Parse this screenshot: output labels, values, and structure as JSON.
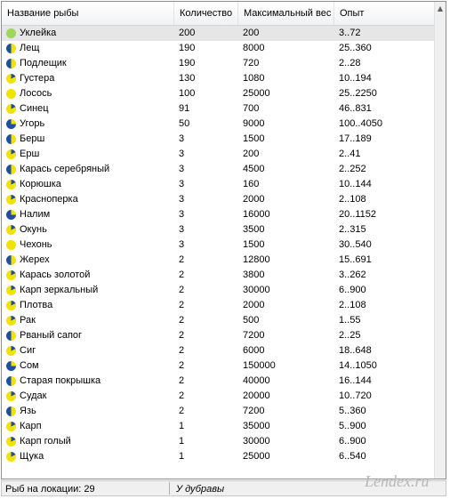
{
  "columns": {
    "name": "Название рыбы",
    "qty": "Количество",
    "max_weight": "Максимальный вес",
    "experience": "Опыт"
  },
  "colors": {
    "row_selected": "#e6e6e6",
    "icon_blue": "#1f4fa3",
    "icon_yellow": "#f2e200",
    "icon_green": "#9ed65a"
  },
  "rows": [
    {
      "name": "Уклейка",
      "qty": "200",
      "max": "200",
      "exp": "3..72",
      "selected": true,
      "icon": "green-circle"
    },
    {
      "name": "Лещ",
      "qty": "190",
      "max": "8000",
      "exp": "25..360",
      "icon": "pie-half"
    },
    {
      "name": "Подлещик",
      "qty": "190",
      "max": "720",
      "exp": "2..28",
      "icon": "pie-half"
    },
    {
      "name": "Густера",
      "qty": "130",
      "max": "1080",
      "exp": "10..194",
      "icon": "pie-small"
    },
    {
      "name": "Лосось",
      "qty": "100",
      "max": "25000",
      "exp": "25..2250",
      "icon": "yellow-circle"
    },
    {
      "name": "Синец",
      "qty": "91",
      "max": "700",
      "exp": "46..831",
      "icon": "pie-small"
    },
    {
      "name": "Угорь",
      "qty": "50",
      "max": "9000",
      "exp": "100..4050",
      "icon": "pie-three-quarter"
    },
    {
      "name": "Берш",
      "qty": "3",
      "max": "1500",
      "exp": "17..189",
      "icon": "pie-half"
    },
    {
      "name": "Ерш",
      "qty": "3",
      "max": "200",
      "exp": "2..41",
      "icon": "pie-small"
    },
    {
      "name": "Карась серебряный",
      "qty": "3",
      "max": "4500",
      "exp": "2..252",
      "icon": "pie-half"
    },
    {
      "name": "Корюшка",
      "qty": "3",
      "max": "160",
      "exp": "10..144",
      "icon": "pie-small"
    },
    {
      "name": "Красноперка",
      "qty": "3",
      "max": "2000",
      "exp": "2..108",
      "icon": "pie-small"
    },
    {
      "name": "Налим",
      "qty": "3",
      "max": "16000",
      "exp": "20..1152",
      "icon": "pie-three-quarter"
    },
    {
      "name": "Окунь",
      "qty": "3",
      "max": "3500",
      "exp": "2..315",
      "icon": "pie-small"
    },
    {
      "name": "Чехонь",
      "qty": "3",
      "max": "1500",
      "exp": "30..540",
      "icon": "yellow-circle"
    },
    {
      "name": "Жерех",
      "qty": "2",
      "max": "12800",
      "exp": "15..691",
      "icon": "pie-half"
    },
    {
      "name": "Карась золотой",
      "qty": "2",
      "max": "3800",
      "exp": "3..262",
      "icon": "pie-small"
    },
    {
      "name": "Карп зеркальный",
      "qty": "2",
      "max": "30000",
      "exp": "6..900",
      "icon": "pie-small"
    },
    {
      "name": "Плотва",
      "qty": "2",
      "max": "2000",
      "exp": "2..108",
      "icon": "pie-small"
    },
    {
      "name": "Рак",
      "qty": "2",
      "max": "500",
      "exp": "1..55",
      "icon": "pie-small"
    },
    {
      "name": "Рваный сапог",
      "qty": "2",
      "max": "7200",
      "exp": "2..25",
      "icon": "pie-half"
    },
    {
      "name": "Сиг",
      "qty": "2",
      "max": "6000",
      "exp": "18..648",
      "icon": "pie-small"
    },
    {
      "name": "Сом",
      "qty": "2",
      "max": "150000",
      "exp": "14..1050",
      "icon": "pie-three-quarter"
    },
    {
      "name": "Старая покрышка",
      "qty": "2",
      "max": "40000",
      "exp": "16..144",
      "icon": "pie-half"
    },
    {
      "name": "Судак",
      "qty": "2",
      "max": "20000",
      "exp": "10..720",
      "icon": "pie-small"
    },
    {
      "name": "Язь",
      "qty": "2",
      "max": "7200",
      "exp": "5..360",
      "icon": "pie-half"
    },
    {
      "name": "Карп",
      "qty": "1",
      "max": "35000",
      "exp": "5..900",
      "icon": "pie-small"
    },
    {
      "name": "Карп голый",
      "qty": "1",
      "max": "30000",
      "exp": "6..900",
      "icon": "pie-small"
    },
    {
      "name": "Щука",
      "qty": "1",
      "max": "25000",
      "exp": "6..540",
      "icon": "pie-small"
    }
  ],
  "status": {
    "count": "Рыб на локации: 29",
    "location": "У дубравы"
  },
  "watermark": "Lendex.ru"
}
